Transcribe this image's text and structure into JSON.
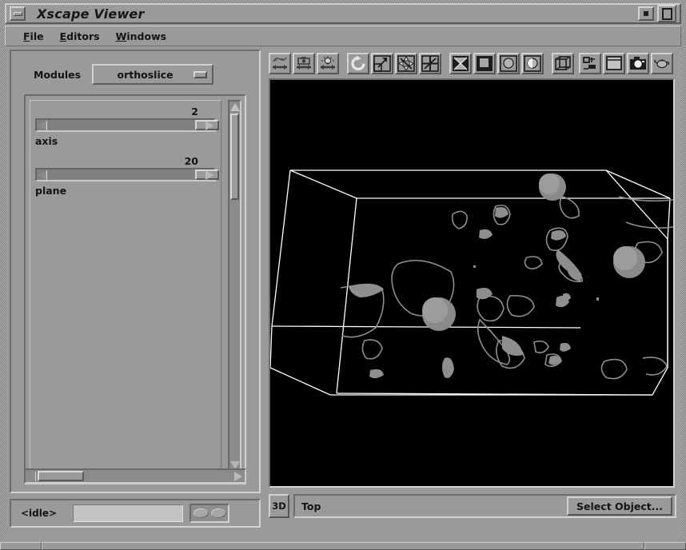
{
  "window": {
    "title": "Xscape Viewer",
    "minimize_icon": "minimize-icon",
    "iconify_icon": "iconify-icon",
    "maximize_icon": "maximize-icon"
  },
  "menubar": {
    "items": [
      {
        "label": "File",
        "mnemonic": "F"
      },
      {
        "label": "Editors",
        "mnemonic": "E"
      },
      {
        "label": "Windows",
        "mnemonic": "W"
      }
    ]
  },
  "modules": {
    "label": "Modules",
    "selected": "orthoslice",
    "options": [
      "orthoslice"
    ],
    "indicator_icon": "option-menu-indicator-icon"
  },
  "sliders": [
    {
      "name": "axis",
      "value": "2",
      "thumb_percent": 88
    },
    {
      "name": "plane",
      "value": "20",
      "thumb_percent": 88
    }
  ],
  "scrollbars": {
    "vertical": {
      "up_icon": "arrow-up-icon",
      "down_icon": "arrow-down-icon",
      "thumb_percent": 23
    },
    "horizontal": {
      "left_icon": "arrow-left-icon",
      "right_icon": "arrow-right-icon",
      "thumb_percent": 21
    }
  },
  "status": {
    "text": "<idle>",
    "progress_value": "",
    "activity_icon": "activity-indicator-icon"
  },
  "toolbar": {
    "buttons": [
      {
        "name": "view-rotate-mode-button",
        "icon": "trackball-rotate-icon"
      },
      {
        "name": "view-pan-mode-button",
        "icon": "camera-pan-icon"
      },
      {
        "name": "view-light-mode-button",
        "icon": "light-bulb-icon"
      },
      {
        "name": "view-reset-button",
        "icon": "circular-arrow-icon"
      },
      {
        "name": "view-all-button",
        "icon": "view-all-box-icon"
      },
      {
        "name": "seek-button",
        "icon": "four-way-arrow-icon"
      },
      {
        "name": "zoom-crosshair-button",
        "icon": "diagonal-crosshair-icon"
      },
      {
        "name": "draw-style-wireframe-button",
        "icon": "bowtie-square-icon"
      },
      {
        "name": "draw-style-filled-button",
        "icon": "filled-square-icon"
      },
      {
        "name": "draw-style-sphere-button",
        "icon": "circle-square-icon"
      },
      {
        "name": "draw-style-half-button",
        "icon": "half-circle-square-icon"
      },
      {
        "name": "bounding-box-button",
        "icon": "cube-outline-icon"
      },
      {
        "name": "perspective-toggle-button",
        "icon": "perspective-icon"
      },
      {
        "name": "clear-window-button",
        "icon": "blank-window-icon"
      },
      {
        "name": "snapshot-button",
        "icon": "camera-icon"
      },
      {
        "name": "teapot-button",
        "icon": "teapot-icon"
      }
    ]
  },
  "viewer": {
    "mode_button": "3D",
    "view_label": "Top",
    "select_object_button": "Select Object...",
    "background_color": "#000000",
    "wireframe_color": "#ffffff",
    "isosurface_color": "#8e8e8e",
    "sphere_color": "#8a8a8a"
  }
}
